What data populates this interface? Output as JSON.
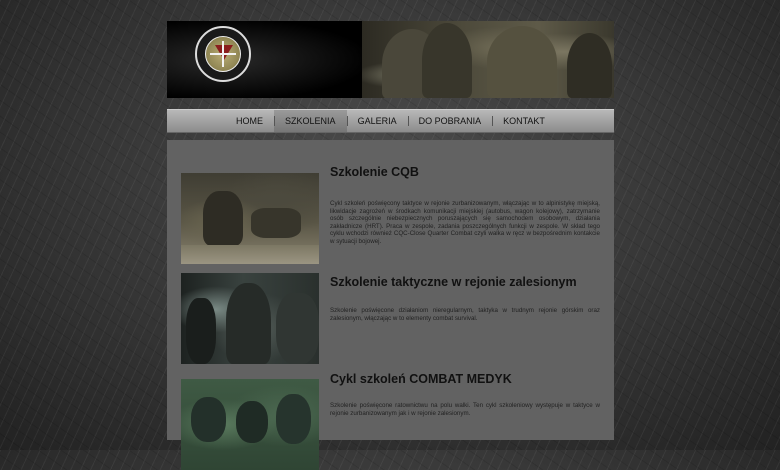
{
  "nav": {
    "items": [
      {
        "label": "HOME"
      },
      {
        "label": "SZKOLENIA"
      },
      {
        "label": "GALERIA"
      },
      {
        "label": "DO POBRANIA"
      },
      {
        "label": "KONTAKT"
      }
    ],
    "active_index": 1
  },
  "articles": [
    {
      "title": "Szkolenie CQB",
      "text": "Cykl szkoleń poświęcony taktyce w rejonie zurbanizowanym, włączając w to alpinistykę miejską, likwidacje zagrożeń w środkach komunikacji miejskiej (autobus, wagon kolejowy), zatrzymanie osób szczególnie niebezpiecznych poruszających się samochodem osobowym, działania zakładnicze (HRT). Praca w zespole, zadania poszczególnych funkcji w zespole. W skład tego cyklu wchodzi również CQC-Close Quarter Combat czyli walka w ręcz w bezpośrednim kontakcie w sytuacji bojowej."
    },
    {
      "title": "Szkolenie taktyczne w rejonie zalesionym",
      "text": "Szkolenie poświęcone działaniom nieregularnym, taktyka w trudnym rejonie górskim oraz zalesionym, włączając w to elementy combat survival."
    },
    {
      "title": "Cykl szkoleń COMBAT MEDYK",
      "text": "Szkolenie poświęcone ratownictwu na polu walki. Ten cykl szkoleniowy występuje w taktyce w rejonie zurbanizowanym jak i w rejonie zalesionym."
    }
  ],
  "colors": {
    "content_bg": "#626262",
    "nav_bg": "#a6a6a6",
    "title_color": "#111111"
  }
}
